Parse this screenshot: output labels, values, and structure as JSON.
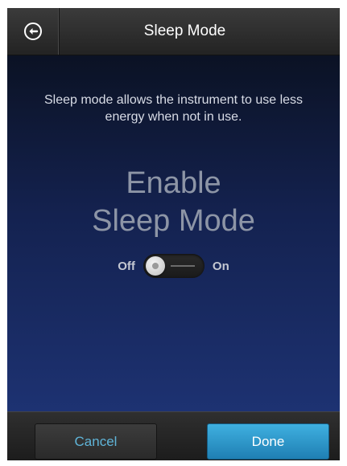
{
  "header": {
    "title": "Sleep Mode",
    "back_icon": "back-arrow-circle-icon"
  },
  "main": {
    "description": "Sleep mode allows the instrument to use less energy when not in use.",
    "heading_line1": "Enable",
    "heading_line2": "Sleep Mode",
    "toggle": {
      "off_label": "Off",
      "on_label": "On",
      "state": "off"
    }
  },
  "footer": {
    "cancel_label": "Cancel",
    "done_label": "Done"
  },
  "colors": {
    "accent": "#2a9bd4",
    "cancel_text": "#5fb4d8"
  }
}
